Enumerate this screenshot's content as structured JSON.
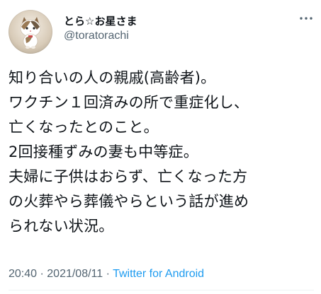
{
  "author": {
    "display_name": "とら☆お星さま",
    "handle": "@toratorachi",
    "avatar_icon": "cat-figurine-avatar"
  },
  "more_icon": "more-dots-icon",
  "tweet": {
    "lines": [
      "知り合いの人の親戚(高齢者)。",
      "ワクチン１回済みの所で重症化し、",
      "亡くなったとのこと。",
      "2回接種ずみの妻も中等症。",
      "夫婦に子供はおらず、亡くなった方",
      "の火葬やら葬儀やらという話が進め",
      "られない状況。"
    ]
  },
  "meta": {
    "time": "20:40",
    "separator1": " · ",
    "date": "2021/08/11",
    "separator2": " · ",
    "source": "Twitter for Android"
  },
  "colors": {
    "text": "#0f1419",
    "secondary": "#536471",
    "link": "#1d9bf0"
  }
}
